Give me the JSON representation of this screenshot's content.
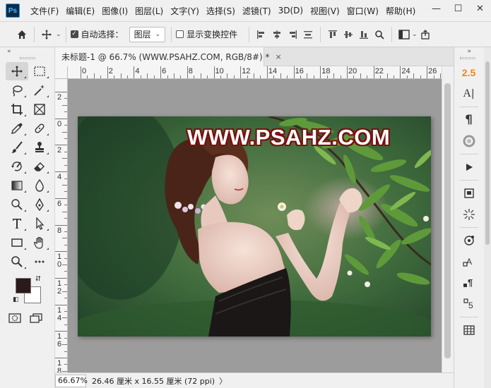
{
  "app": {
    "logo_text": "Ps",
    "menu": [
      "文件(F)",
      "编辑(E)",
      "图像(I)",
      "图层(L)",
      "文字(Y)",
      "选择(S)",
      "滤镜(T)",
      "3D(D)",
      "视图(V)",
      "窗口(W)",
      "帮助(H)"
    ],
    "window_controls": [
      "—",
      "☐",
      "✕"
    ]
  },
  "options_bar": {
    "auto_select_label": "自动选择：",
    "auto_select_checked": true,
    "auto_select_target": "图层",
    "show_transform_label": "显示变换控件",
    "show_transform_checked": false
  },
  "document": {
    "tab_title": "未标题-1 @ 66.7% (WWW.PSAHZ.COM, RGB/8#) *",
    "tab_close": "×",
    "ruler_top_labels": [
      "0",
      "2",
      "4",
      "6",
      "8",
      "10",
      "12",
      "14",
      "16",
      "18",
      "20",
      "22",
      "24",
      "26"
    ],
    "ruler_left_labels": [
      "2",
      "0",
      "2",
      "4",
      "6",
      "8",
      "1\n0",
      "1\n2",
      "1\n4",
      "1\n6",
      "1\n8"
    ],
    "watermark_text": "WWW.PSAHZ.COM",
    "zoom": "66.67%",
    "doc_info": "26.46 厘米 x 16.55 厘米 (72 ppi)",
    "status_arrow": "〉"
  },
  "right_panel": {
    "version": "2.5"
  },
  "colors": {
    "foreground": "#2a1a1a",
    "background": "#ffffff",
    "canvas_bg": "#9c9c9c",
    "accent": "#e8891a",
    "watermark_outline": "#7a1010"
  }
}
